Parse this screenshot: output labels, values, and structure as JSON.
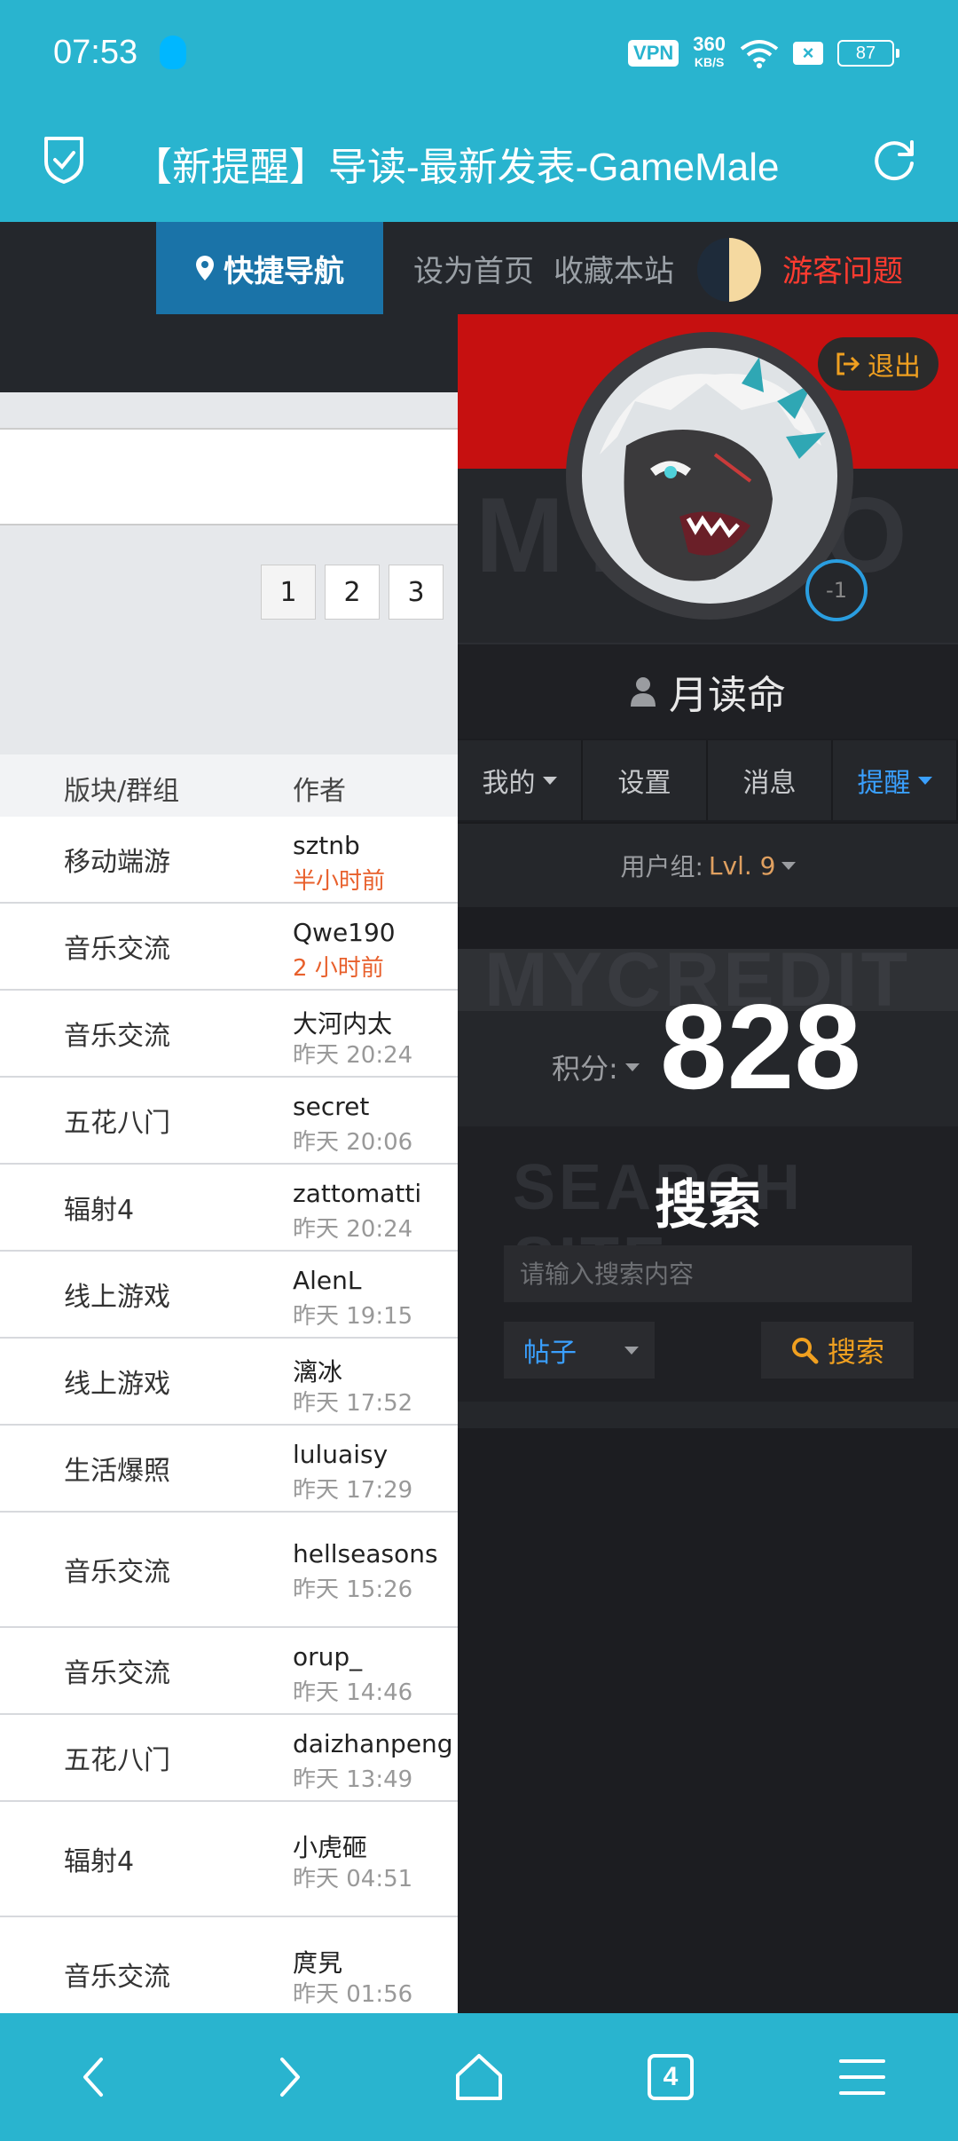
{
  "status": {
    "time": "07:53",
    "vpn": "VPN",
    "net_speed": "360",
    "net_unit": "KB/S",
    "sim_label": "×",
    "battery": "87"
  },
  "browser": {
    "title": "【新提醒】导读-最新发表-GameMale"
  },
  "site_nav": {
    "quick_nav": "快捷导航",
    "set_home": "设为首页",
    "bookmark": "收藏本站",
    "guest": "游客问题"
  },
  "list": {
    "pages": [
      "1",
      "2",
      "3"
    ],
    "headers": {
      "forum": "版块/群组",
      "author": "作者"
    },
    "rows": [
      {
        "forum": "移动端游",
        "author": "sztnb",
        "time": "半小时前",
        "hot": true
      },
      {
        "forum": "音乐交流",
        "author": "Qwe190",
        "time": "2 小时前",
        "hot": true
      },
      {
        "forum": "音乐交流",
        "author": "大河内太",
        "time": "昨天 20:24"
      },
      {
        "forum": "五花八门",
        "author": "secret",
        "time": "昨天 20:06"
      },
      {
        "forum": "辐射4",
        "author": "zattomatti",
        "time": "昨天 20:24"
      },
      {
        "forum": "线上游戏",
        "author": "AlenL",
        "time": "昨天 19:15"
      },
      {
        "forum": "线上游戏",
        "author": "漓冰",
        "time": "昨天 17:52"
      },
      {
        "forum": "生活爆照",
        "author": "luluaisy",
        "time": "昨天 17:29"
      },
      {
        "forum": "音乐交流",
        "author": "hellseasons",
        "time": "昨天 15:26",
        "tall": true
      },
      {
        "forum": "音乐交流",
        "author": "orup_",
        "time": "昨天 14:46"
      },
      {
        "forum": "五花八门",
        "author": "daizhanpeng",
        "time": "昨天 13:49"
      },
      {
        "forum": "辐射4",
        "author": "小虎砸",
        "time": "昨天 04:51",
        "tall": true
      },
      {
        "forum": "音乐交流",
        "author": "庹旯",
        "time": "昨天 01:56",
        "tall": true
      }
    ]
  },
  "panel": {
    "logout": "退出",
    "level_badge": "-1",
    "watermark_top": "MYINFO",
    "username": "月读命",
    "tabs": [
      "我的",
      "设置",
      "消息",
      "提醒"
    ],
    "usergroup_label": "用户组:",
    "usergroup_level": "Lvl. 9",
    "watermark_credit": "MYCREDIT",
    "credit_label": "积分:",
    "credit_value": "828",
    "watermark_search": "SEARCH SITE",
    "search_title": "搜索",
    "search_placeholder": "请输入搜索内容",
    "search_type": "帖子",
    "search_button": "搜索"
  },
  "bottom_nav": {
    "tab_count": "4"
  },
  "colors": {
    "accent": "#29b4cf",
    "nav_dark": "#24272c",
    "panel_red": "#c61010",
    "link_blue": "#3aa0ff",
    "orange": "#f0a020",
    "hot_time": "#e8602c"
  }
}
